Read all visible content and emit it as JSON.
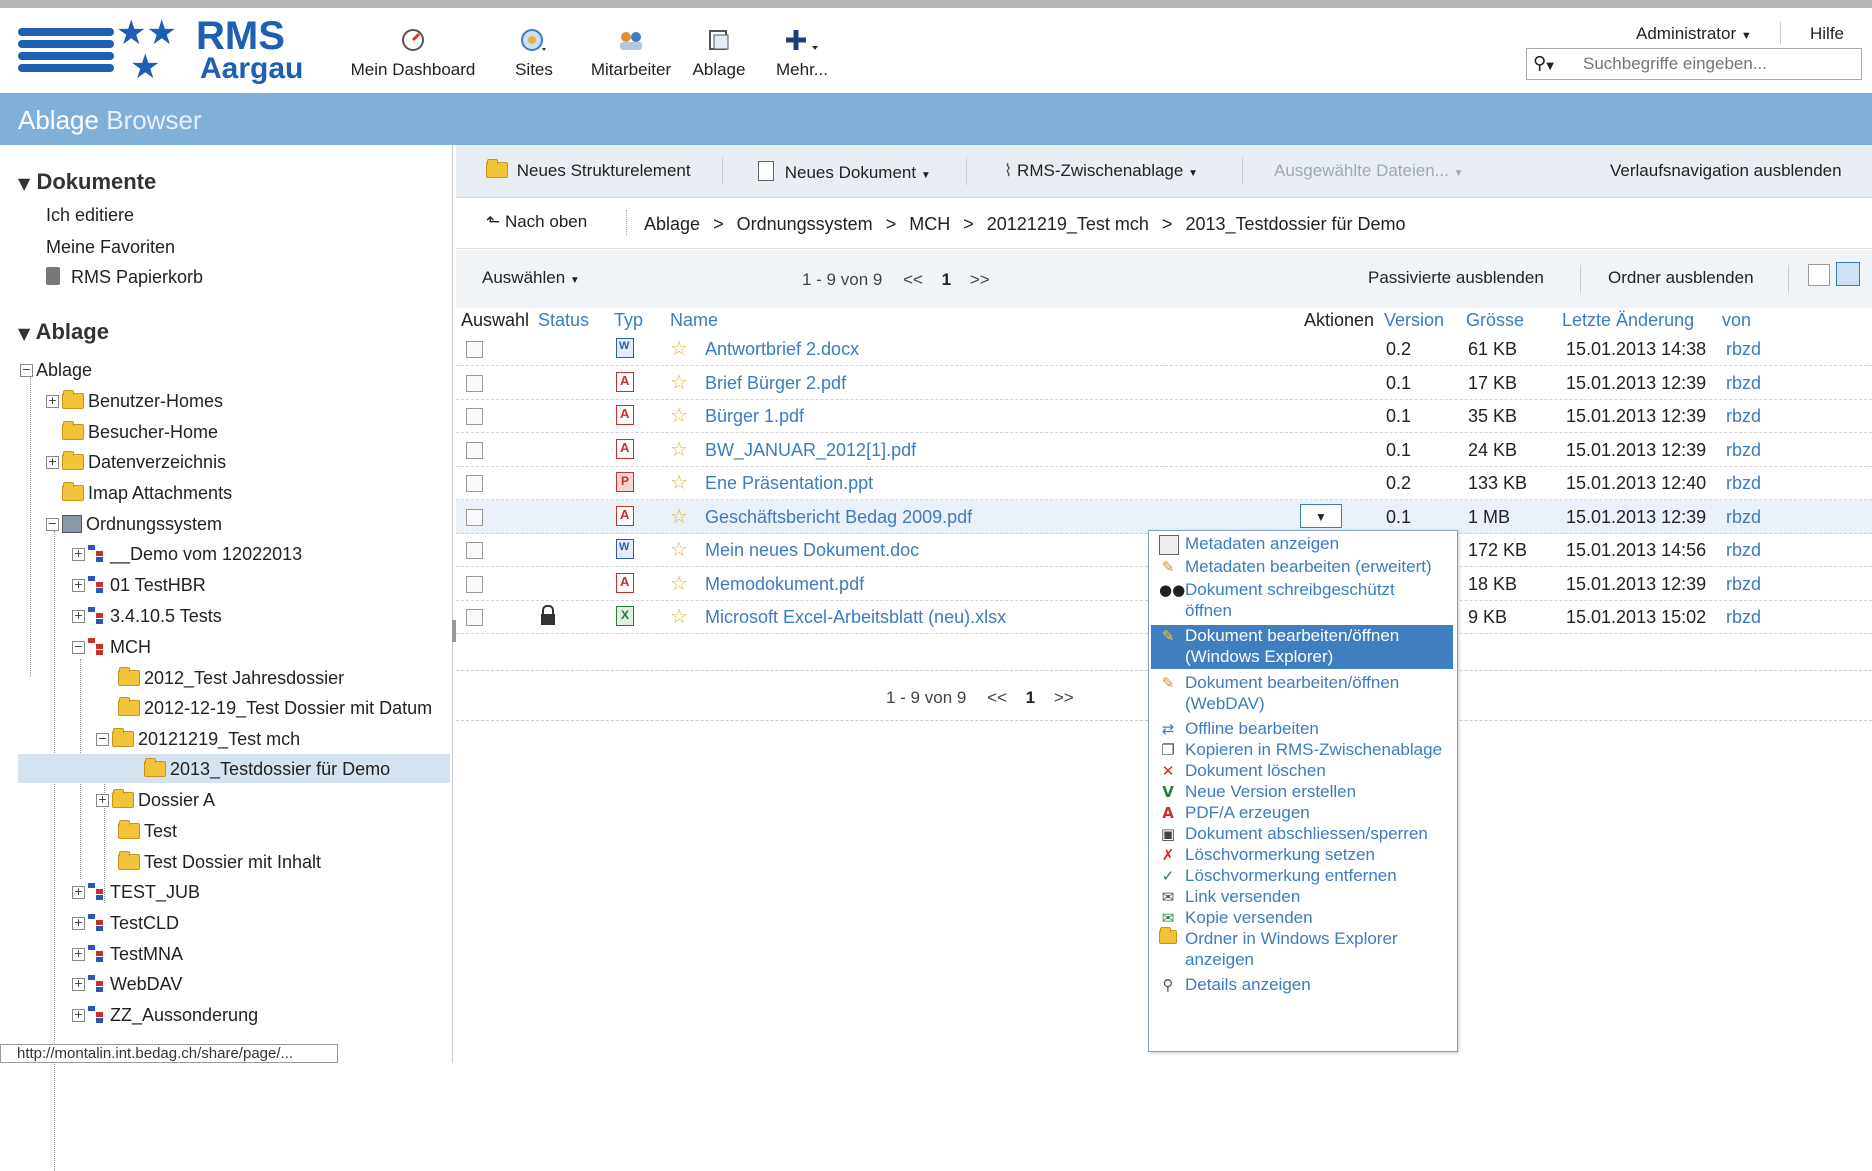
{
  "logo": {
    "line1": "RMS",
    "line2": "Aargau"
  },
  "nav": [
    {
      "label": "Mein Dashboard",
      "icon": "dashboard-icon"
    },
    {
      "label": "Sites",
      "icon": "sites-icon"
    },
    {
      "label": "Mitarbeiter",
      "icon": "people-icon"
    },
    {
      "label": "Ablage",
      "icon": "repository-icon"
    },
    {
      "label": "Mehr...",
      "icon": "plus-icon"
    }
  ],
  "user": {
    "name": "Administrator",
    "help": "Hilfe"
  },
  "search": {
    "placeholder": "Suchbegriffe eingeben..."
  },
  "title": {
    "part1": "Ablage",
    "part2": "Browser"
  },
  "sidebar": {
    "documents_heading": "Dokumente",
    "doc_links": [
      "Ich editiere",
      "Meine Favoriten",
      "RMS Papierkorb"
    ],
    "repo_heading": "Ablage",
    "tree": [
      {
        "label": "Ablage"
      },
      {
        "label": "Benutzer-Homes"
      },
      {
        "label": "Besucher-Home"
      },
      {
        "label": "Datenverzeichnis"
      },
      {
        "label": "Imap Attachments"
      },
      {
        "label": "Ordnungssystem"
      },
      {
        "label": "__Demo vom 12022013"
      },
      {
        "label": "01 TestHBR"
      },
      {
        "label": "3.4.10.5 Tests"
      },
      {
        "label": "MCH"
      },
      {
        "label": "2012_Test Jahresdossier"
      },
      {
        "label": "2012-12-19_Test Dossier mit Datum"
      },
      {
        "label": "20121219_Test mch"
      },
      {
        "label": "2013_Testdossier für Demo"
      },
      {
        "label": "Dossier A"
      },
      {
        "label": "Test"
      },
      {
        "label": "Test Dossier mit Inhalt"
      },
      {
        "label": "TEST_JUB"
      },
      {
        "label": "TestCLD"
      },
      {
        "label": "TestMNA"
      },
      {
        "label": "WebDAV"
      },
      {
        "label": "ZZ_Aussonderung"
      }
    ]
  },
  "toolbar": {
    "new_structure": "Neues Strukturelement",
    "new_document": "Neues Dokument",
    "clipboard": "RMS-Zwischenablage",
    "selected_files": "Ausgewählte Dateien...",
    "hide_nav": "Verlaufsnavigation ausblenden"
  },
  "breadcrumb": {
    "up": "Nach oben",
    "items": [
      "Ablage",
      "Ordnungssystem",
      "MCH",
      "20121219_Test mch",
      "2013_Testdossier für Demo"
    ],
    "separator": ">"
  },
  "listbar": {
    "select": "Auswählen",
    "paging": "1 - 9 von 9",
    "prev": "<<",
    "page": "1",
    "next": ">>",
    "hide_passive": "Passivierte ausblenden",
    "hide_folders": "Ordner ausblenden"
  },
  "columns": {
    "auswahl": "Auswahl",
    "status": "Status",
    "typ": "Typ",
    "name": "Name",
    "aktionen": "Aktionen",
    "version": "Version",
    "groesse": "Grösse",
    "letzte": "Letzte Änderung",
    "von": "von"
  },
  "files": [
    {
      "name": "Antwortbrief 2.docx",
      "type": "doc",
      "version": "0.2",
      "size": "61 KB",
      "date": "15.01.2013 14:38",
      "by": "rbzd"
    },
    {
      "name": "Brief Bürger 2.pdf",
      "type": "pdf",
      "version": "0.1",
      "size": "17 KB",
      "date": "15.01.2013 12:39",
      "by": "rbzd"
    },
    {
      "name": "Bürger 1.pdf",
      "type": "pdf",
      "version": "0.1",
      "size": "35 KB",
      "date": "15.01.2013 12:39",
      "by": "rbzd"
    },
    {
      "name": "BW_JANUAR_2012[1].pdf",
      "type": "pdf",
      "version": "0.1",
      "size": "24 KB",
      "date": "15.01.2013 12:39",
      "by": "rbzd"
    },
    {
      "name": "Ene Präsentation.ppt",
      "type": "ppt",
      "version": "0.2",
      "size": "133 KB",
      "date": "15.01.2013 12:40",
      "by": "rbzd"
    },
    {
      "name": "Geschäftsbericht Bedag 2009.pdf",
      "type": "pdf",
      "version": "0.1",
      "size": "1 MB",
      "date": "15.01.2013 12:39",
      "by": "rbzd"
    },
    {
      "name": "Mein neues Dokument.doc",
      "type": "doc",
      "version": "",
      "size": "172 KB",
      "date": "15.01.2013 14:56",
      "by": "rbzd"
    },
    {
      "name": "Memodokument.pdf",
      "type": "pdf",
      "version": "",
      "size": "18 KB",
      "date": "15.01.2013 12:39",
      "by": "rbzd"
    },
    {
      "name": "Microsoft Excel-Arbeitsblatt (neu).xlsx",
      "type": "xls",
      "version": "",
      "size": "9 KB",
      "date": "15.01.2013 15:02",
      "by": "rbzd"
    }
  ],
  "context_menu": [
    {
      "line1": "Metadaten anzeigen",
      "line2": ""
    },
    {
      "line1": "Metadaten bearbeiten (erweitert)",
      "line2": ""
    },
    {
      "line1": "Dokument schreibgeschützt",
      "line2": "öffnen"
    },
    {
      "line1": "Dokument bearbeiten/öffnen",
      "line2": "(Windows Explorer)"
    },
    {
      "line1": "Dokument bearbeiten/öffnen",
      "line2": "(WebDAV)"
    },
    {
      "line1": "Offline bearbeiten",
      "line2": ""
    },
    {
      "line1": "Kopieren in RMS-Zwischenablage",
      "line2": ""
    },
    {
      "line1": "Dokument löschen",
      "line2": ""
    },
    {
      "line1": "Neue Version erstellen",
      "line2": ""
    },
    {
      "line1": "PDF/A erzeugen",
      "line2": ""
    },
    {
      "line1": "Dokument abschliessen/sperren",
      "line2": ""
    },
    {
      "line1": "Löschvormerkung setzen",
      "line2": ""
    },
    {
      "line1": "Löschvormerkung entfernen",
      "line2": ""
    },
    {
      "line1": "Link versenden",
      "line2": ""
    },
    {
      "line1": "Kopie versenden",
      "line2": ""
    },
    {
      "line1": "Ordner in Windows Explorer",
      "line2": "anzeigen"
    },
    {
      "line1": "Details anzeigen",
      "line2": ""
    }
  ],
  "status_url": "http://montalin.int.bedag.ch/share/page/..."
}
